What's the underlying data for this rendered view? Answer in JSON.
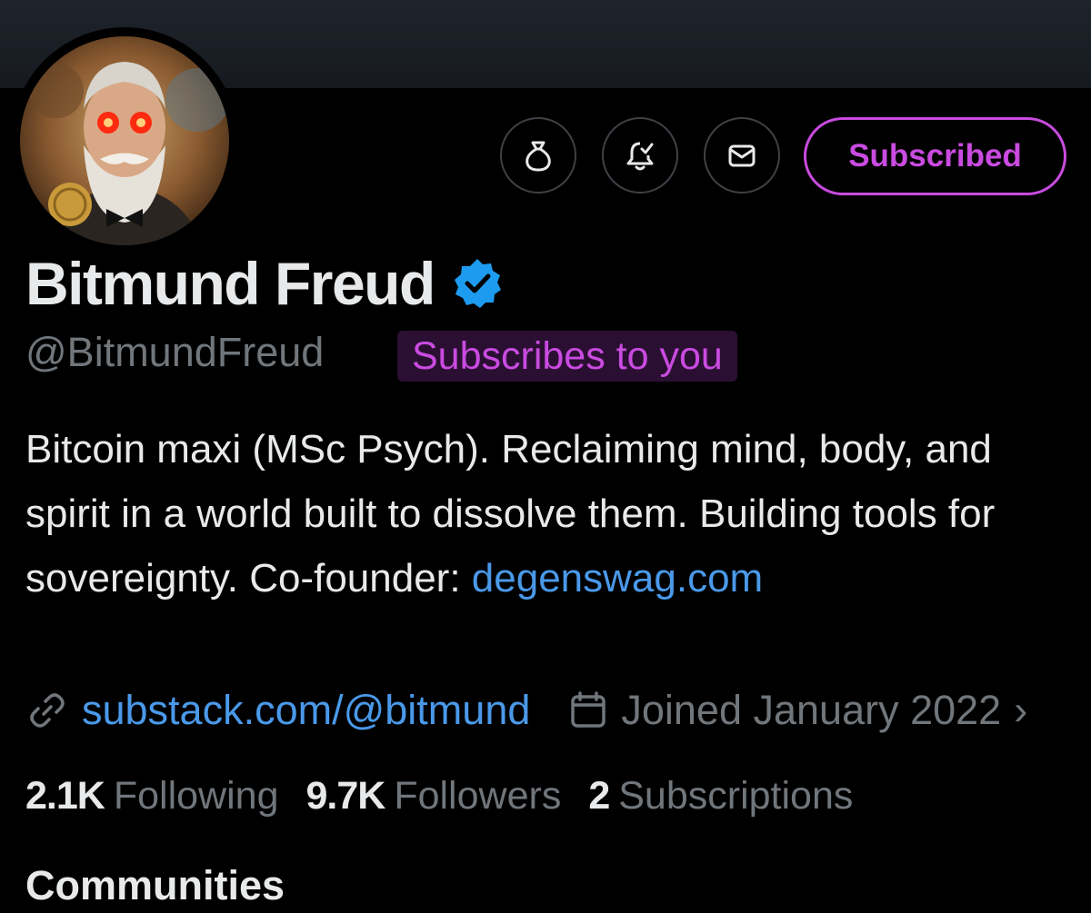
{
  "profile": {
    "display_name": "Bitmund Freud",
    "handle": "@BitmundFreud",
    "subscribes_badge": "Subscribes to you",
    "bio_text": "Bitcoin maxi (MSc Psych). Reclaiming mind, body, and spirit in a world built to dissolve them. Building tools for sovereignty. Co-founder: ",
    "bio_link": "degenswag.com",
    "website": "substack.com/@bitmund",
    "joined": "Joined January 2022",
    "more_indicator": "›"
  },
  "actions": {
    "tip_icon": "money-bag-icon",
    "notify_icon": "bell-check-icon",
    "message_icon": "envelope-icon",
    "subscribed_label": "Subscribed"
  },
  "stats": {
    "following_count": "2.1K",
    "following_label": "Following",
    "followers_count": "9.7K",
    "followers_label": "Followers",
    "subscriptions_count": "2",
    "subscriptions_label": "Subscriptions"
  },
  "next_section": {
    "label": "Communities"
  },
  "colors": {
    "background": "#000000",
    "accent_purple": "#c94be0",
    "link_blue": "#4a99e9",
    "muted_text": "#71767b",
    "verified_blue": "#1d9bf0"
  }
}
